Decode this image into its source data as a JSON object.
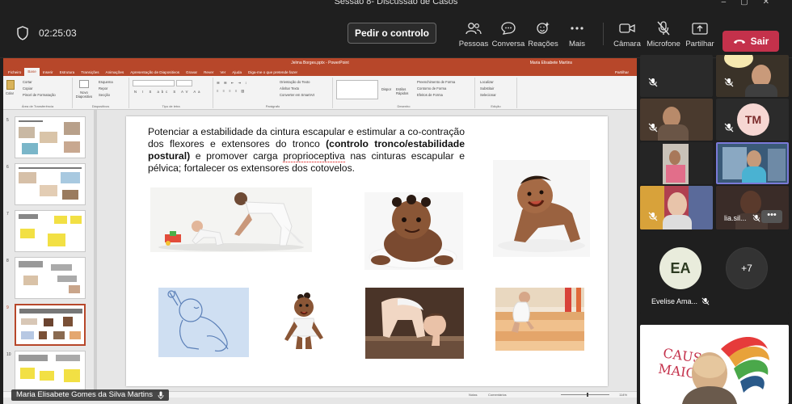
{
  "window": {
    "title": "Sessão 8- Discussão de Casos"
  },
  "meeting": {
    "timer": "02:25:03",
    "request_control": "Pedir o controlo",
    "toolbar": [
      {
        "label": "Pessoas",
        "icon": "people-icon"
      },
      {
        "label": "Conversa",
        "icon": "chat-icon"
      },
      {
        "label": "Reações",
        "icon": "reactions-icon"
      },
      {
        "label": "Mais",
        "icon": "more-icon"
      },
      {
        "label": "Câmara",
        "icon": "camera-icon"
      },
      {
        "label": "Microfone",
        "icon": "microphone-muted-icon"
      },
      {
        "label": "Partilhar",
        "icon": "share-icon"
      }
    ],
    "leave": "Sair"
  },
  "ppt": {
    "file_title": "Jelma Borges.pptx - PowerPoint",
    "user": "Maria Elisabete Martins",
    "tabs": [
      "Ficheiro",
      "Base",
      "Inserir",
      "Estrutura",
      "Transições",
      "Animações",
      "Apresentação de Diapositivos",
      "Gravar",
      "Rever",
      "Ver",
      "Ajuda",
      "Diga-me o que pretende fazer"
    ],
    "active_tab": "Base",
    "share": "Partilhar",
    "ribbon": {
      "clipboard": {
        "paste": "Colar",
        "cut": "Cortar",
        "copy": "Copiar",
        "format_painter": "Pincel de Formatação",
        "group": "Área de Transferência"
      },
      "slides": {
        "new": "Novo Diapositivo",
        "layout": "Esquema",
        "reset": "Repor",
        "section": "Secção",
        "group": "Diapositivos"
      },
      "font_group": "Tipo de letra",
      "paragraph": {
        "dir": "Orientação do Texto",
        "align": "Alinhar Texto",
        "smartart": "Converter em SmartArt",
        "group": "Parágrafo"
      },
      "drawing": {
        "arrange": "Dispor",
        "quick": "Estilos Rápidos",
        "fill": "Preenchimento de Forma",
        "outline": "Contorno de Forma",
        "effects": "Efeitos de Forma",
        "group": "Desenho"
      },
      "editing": {
        "find": "Localizar",
        "replace": "Substituir",
        "select": "Selecionar",
        "group": "Edição"
      }
    },
    "thumb_numbers": [
      "5",
      "6",
      "7",
      "8",
      "9",
      "10"
    ],
    "selected_thumb": "9",
    "slide_text": {
      "part1": "Potenciar a estabilidade da cintura escapular e estimular a co-contração dos flexores e extensores do tronco ",
      "bold": "(controlo tronco/estabilidade postural)",
      "part2": " e promover carga ",
      "underlined": "proprioceptiva",
      "part3": " nas cinturas escapular e pélvica; fortalecer os extensores dos cotovelos."
    },
    "status": {
      "notes": "Notas",
      "comments": "Comentários",
      "zoom": "114%"
    }
  },
  "presenter_name": "Maria Elisabete Gomes da Silva Martins",
  "participants": {
    "tm_initials": "TM",
    "lia_name": "lia.sil...",
    "ea_initials": "EA",
    "ea_name": "Evelise Ama...",
    "more_count": "+7"
  },
  "colors": {
    "leave": "#c4314b",
    "ppt_brand": "#b7472a",
    "tm_avatar": "#f6d7d3",
    "ea_avatar": "#e9ecdc"
  }
}
